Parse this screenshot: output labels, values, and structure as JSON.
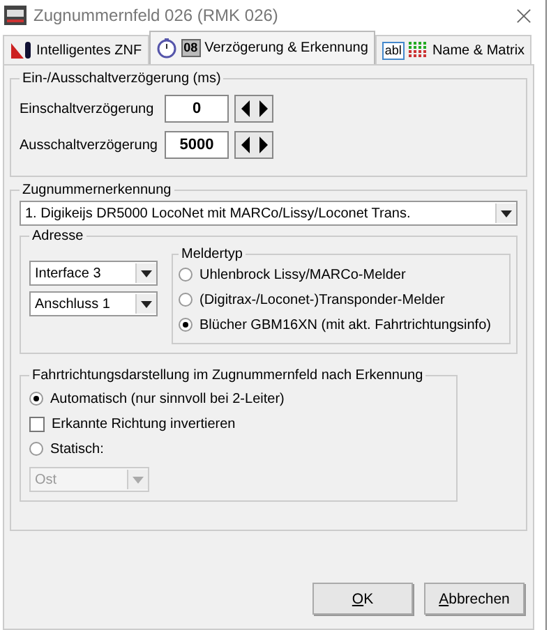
{
  "window": {
    "title": "Zugnummernfeld 026 (RMK 026)"
  },
  "tabs": [
    {
      "label": "Intelligentes ZNF",
      "kind": "flag",
      "selected": false
    },
    {
      "label": "Verzögerung & Erkennung",
      "kind": "timer",
      "icon_text": "08",
      "selected": true
    },
    {
      "label": "Name & Matrix",
      "kind": "matrix",
      "icon_text": "abl",
      "selected": false
    }
  ],
  "delay_group": {
    "title": "Ein-/Ausschaltverzögerung (ms)",
    "rows": [
      {
        "label": "Einschaltverzögerung",
        "value": "0"
      },
      {
        "label": "Ausschaltverzögerung",
        "value": "5000"
      }
    ]
  },
  "detection_group": {
    "title": "Zugnummernerkennung",
    "system": "1. Digikeijs DR5000 LocoNet mit MARCo/Lissy/Loconet Trans.",
    "address": {
      "title": "Adresse",
      "interface": "Interface 3",
      "port": "Anschluss 1"
    },
    "detector_type": {
      "title": "Meldertyp",
      "options": [
        {
          "label": "Uhlenbrock Lissy/MARCo-Melder",
          "selected": false
        },
        {
          "label": "(Digitrax-/Loconet-)Transponder-Melder",
          "selected": false
        },
        {
          "label": "Blücher GBM16XN (mit akt. Fahrtrichtungsinfo)",
          "selected": true
        }
      ]
    },
    "direction": {
      "title": "Fahrtrichtungsdarstellung  im Zugnummernfeld nach Erkennung",
      "items": [
        {
          "kind": "radio",
          "label": "Automatisch (nur sinnvoll bei 2-Leiter)",
          "selected": true
        },
        {
          "kind": "checkbox",
          "label": "Erkannte Richtung invertieren",
          "checked": false
        },
        {
          "kind": "radio",
          "label": "Statisch:",
          "selected": false
        }
      ],
      "static_value": {
        "value": "Ost",
        "disabled": true
      }
    }
  },
  "buttons": [
    "OK",
    "Abbrechen"
  ]
}
